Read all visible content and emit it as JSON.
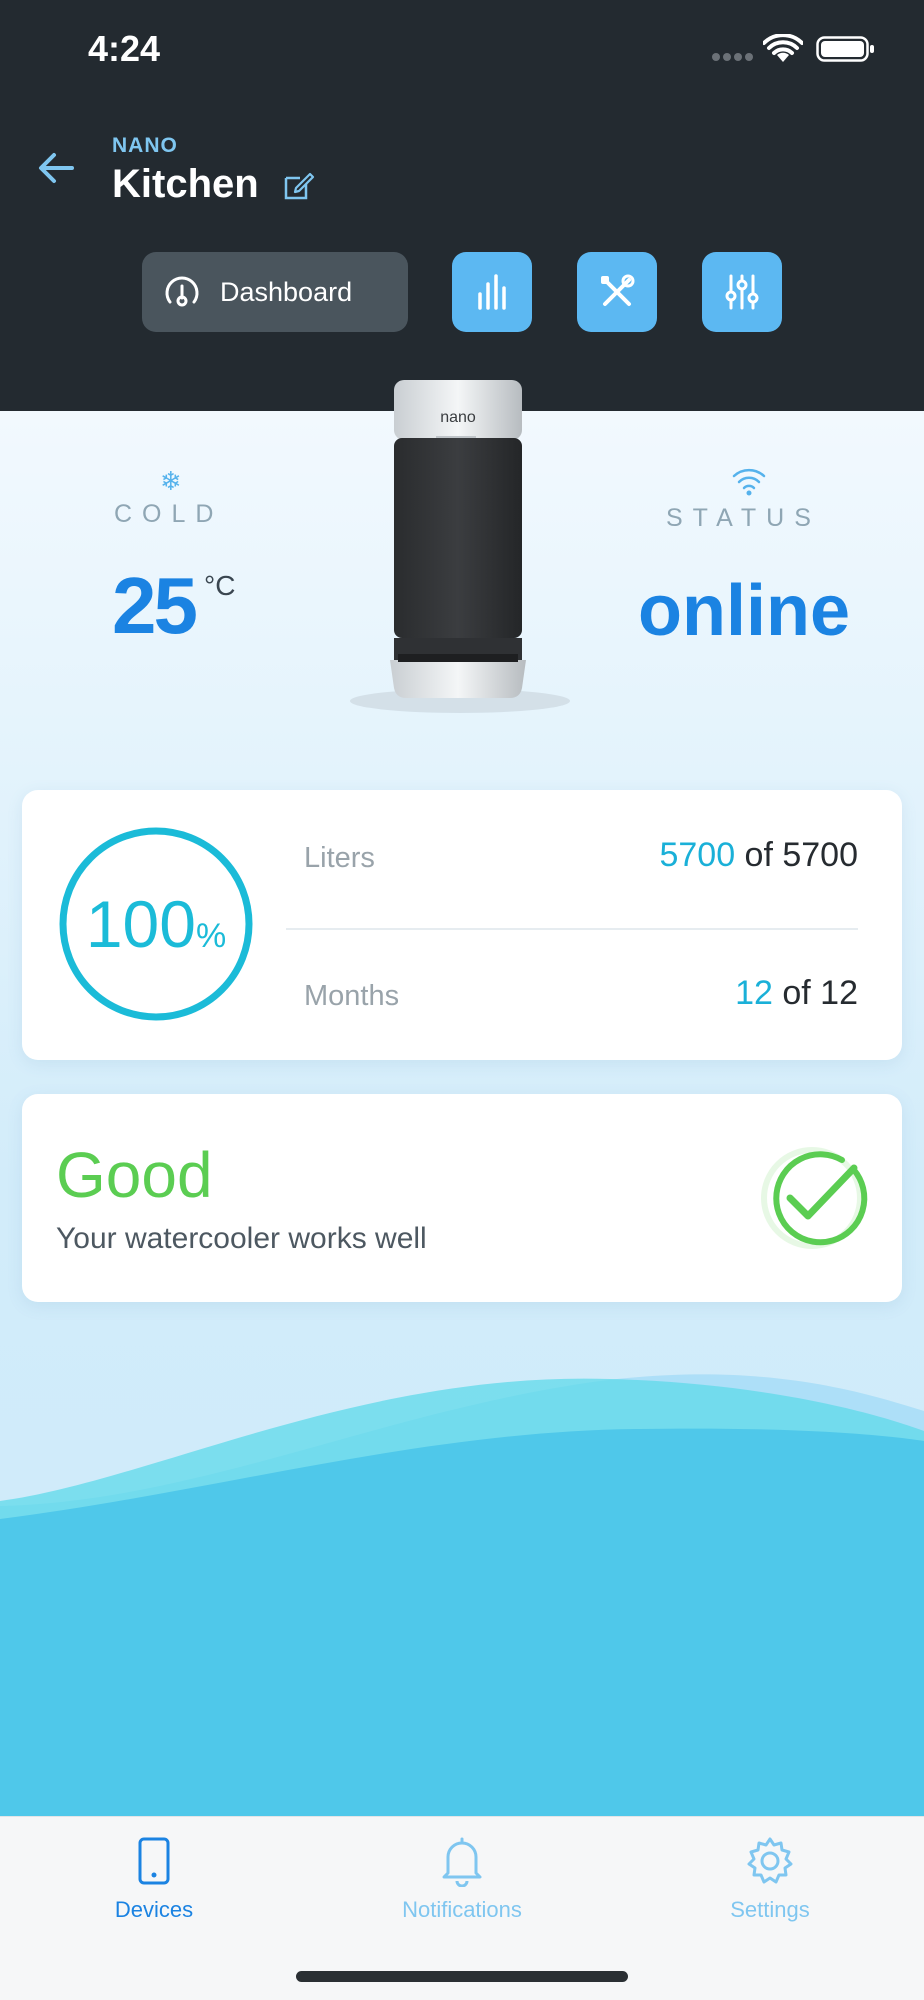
{
  "status_bar": {
    "time": "4:24"
  },
  "header": {
    "brand": "NANO",
    "title": "Kitchen",
    "tabs": [
      {
        "label": "Dashboard",
        "icon": "gauge-icon",
        "active": true
      },
      {
        "icon": "bar-chart-icon"
      },
      {
        "icon": "tools-icon"
      },
      {
        "icon": "sliders-icon"
      }
    ]
  },
  "summary": {
    "cold": {
      "label": "COLD",
      "value": "25",
      "unit": "°C"
    },
    "status": {
      "label": "STATUS",
      "value": "online"
    }
  },
  "usage": {
    "percent": "100",
    "percent_sign": "%",
    "progress_fraction": 1.0,
    "liters": {
      "label": "Liters",
      "current": "5700",
      "of_text": " of 5700"
    },
    "months": {
      "label": "Months",
      "current": "12",
      "of_text": " of 12"
    }
  },
  "health": {
    "title": "Good",
    "description": "Your watercooler works well",
    "icon": "check-circle-icon"
  },
  "bottom_nav": [
    {
      "label": "Devices",
      "icon": "phone-icon",
      "active": true
    },
    {
      "label": "Notifications",
      "icon": "bell-icon",
      "active": false
    },
    {
      "label": "Settings",
      "icon": "gear-icon",
      "active": false
    }
  ],
  "colors": {
    "header_bg": "#232a30",
    "accent_blue": "#1b83e2",
    "accent_cyan": "#1bbbd8",
    "good_green": "#5bcd52",
    "wave": "#4fc8ea"
  }
}
